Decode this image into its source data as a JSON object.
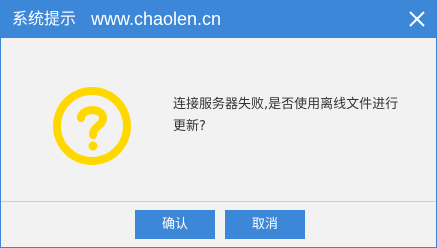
{
  "dialog": {
    "title": "系统提示",
    "url": "www.chaolen.cn",
    "close_icon": "close-icon",
    "message_line1": "连接服务器失败,是否使用离线文件进行",
    "message_line2": "更新?",
    "icon": "question-icon",
    "icon_color": "#ffd800",
    "accent": "#3d87d8"
  },
  "buttons": {
    "confirm_label": "确认",
    "cancel_label": "取消"
  }
}
